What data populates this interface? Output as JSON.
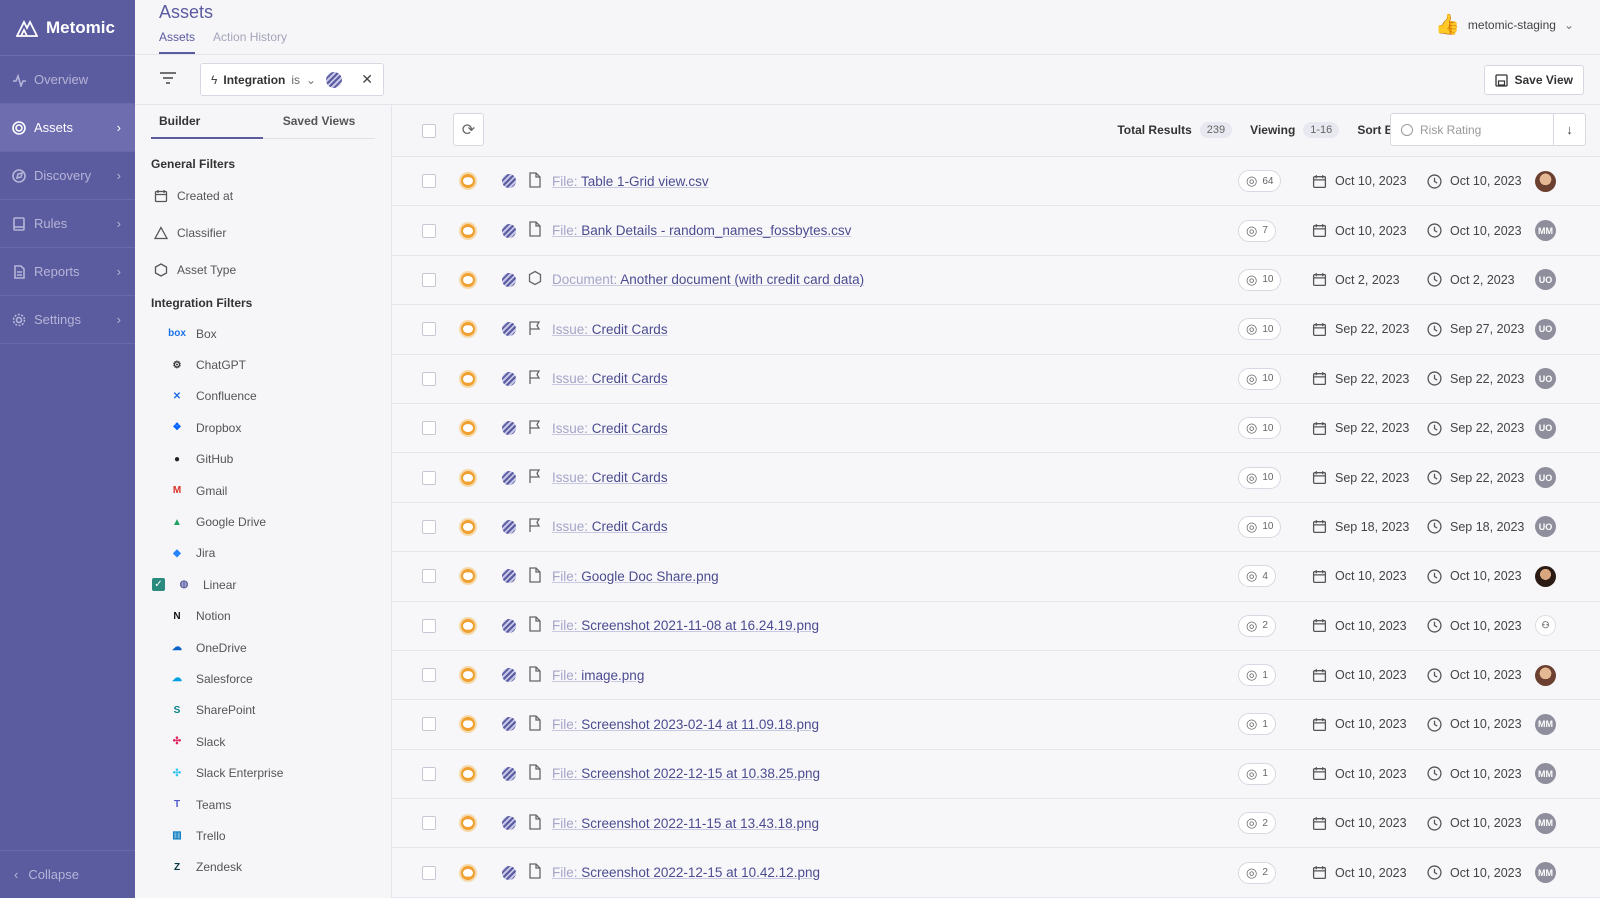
{
  "app": {
    "name": "Metomic"
  },
  "sidebar": {
    "items": [
      {
        "label": "Overview",
        "icon": "activity-icon",
        "active": false,
        "chevron": false
      },
      {
        "label": "Assets",
        "icon": "target-icon",
        "active": true,
        "chevron": true
      },
      {
        "label": "Discovery",
        "icon": "compass-icon",
        "active": false,
        "chevron": true
      },
      {
        "label": "Rules",
        "icon": "book-icon",
        "active": false,
        "chevron": true
      },
      {
        "label": "Reports",
        "icon": "report-icon",
        "active": false,
        "chevron": true
      },
      {
        "label": "Settings",
        "icon": "gear-icon",
        "active": false,
        "chevron": true
      }
    ],
    "collapse_label": "Collapse"
  },
  "header": {
    "title": "Assets",
    "tabs": [
      {
        "label": "Assets",
        "active": true
      },
      {
        "label": "Action History",
        "active": false
      }
    ],
    "account": "metomic-staging"
  },
  "filterbar": {
    "chip": {
      "field": "Integration",
      "operator": "is"
    },
    "save_view_label": "Save View"
  },
  "panel": {
    "tabs": [
      "Builder",
      "Saved Views"
    ],
    "general_title": "General Filters",
    "general": [
      {
        "label": "Created at",
        "icon": "calendar-icon"
      },
      {
        "label": "Classifier",
        "icon": "triangle-icon"
      },
      {
        "label": "Asset Type",
        "icon": "hexagon-icon"
      }
    ],
    "integration_title": "Integration Filters",
    "integrations": [
      {
        "label": "Box",
        "glyph": "box",
        "color": "#1a73e8",
        "checked": false
      },
      {
        "label": "ChatGPT",
        "glyph": "⚙",
        "color": "#333333",
        "checked": false
      },
      {
        "label": "Confluence",
        "glyph": "✕",
        "color": "#1f6feb",
        "checked": false
      },
      {
        "label": "Dropbox",
        "glyph": "❖",
        "color": "#0061fe",
        "checked": false
      },
      {
        "label": "GitHub",
        "glyph": "●",
        "color": "#222222",
        "checked": false
      },
      {
        "label": "Gmail",
        "glyph": "M",
        "color": "#d93025",
        "checked": false
      },
      {
        "label": "Google Drive",
        "glyph": "▲",
        "color": "#1ea362",
        "checked": false
      },
      {
        "label": "Jira",
        "glyph": "◆",
        "color": "#2684ff",
        "checked": false
      },
      {
        "label": "Linear",
        "glyph": "◍",
        "color": "#5b5ba0",
        "checked": true
      },
      {
        "label": "Notion",
        "glyph": "N",
        "color": "#111111",
        "checked": false
      },
      {
        "label": "OneDrive",
        "glyph": "☁",
        "color": "#0a64c8",
        "checked": false
      },
      {
        "label": "Salesforce",
        "glyph": "☁",
        "color": "#00a1e0",
        "checked": false
      },
      {
        "label": "SharePoint",
        "glyph": "S",
        "color": "#038387",
        "checked": false
      },
      {
        "label": "Slack",
        "glyph": "✣",
        "color": "#e01e5a",
        "checked": false
      },
      {
        "label": "Slack Enterprise",
        "glyph": "✣",
        "color": "#36c5f0",
        "checked": false
      },
      {
        "label": "Teams",
        "glyph": "T",
        "color": "#5059c9",
        "checked": false
      },
      {
        "label": "Trello",
        "glyph": "▥",
        "color": "#0079bf",
        "checked": false
      },
      {
        "label": "Zendesk",
        "glyph": "Z",
        "color": "#03363d",
        "checked": false
      }
    ]
  },
  "results": {
    "total_label": "Total Results",
    "total": "239",
    "viewing_label": "Viewing",
    "viewing": "1-16",
    "sort_label": "Sort By",
    "sort_value": "Risk Rating",
    "rows": [
      {
        "kind": "File:",
        "name": "Table 1-Grid view.csv",
        "type": "file",
        "count": "64",
        "created": "Oct 10, 2023",
        "updated": "Oct 10, 2023",
        "user": "photo"
      },
      {
        "kind": "File:",
        "name": "Bank Details - random_names_fossbytes.csv",
        "type": "file",
        "count": "7",
        "created": "Oct 10, 2023",
        "updated": "Oct 10, 2023",
        "user": "MM"
      },
      {
        "kind": "Document:",
        "name": "Another document (with credit card data)",
        "type": "document",
        "count": "10",
        "created": "Oct 2, 2023",
        "updated": "Oct 2, 2023",
        "user": "UO"
      },
      {
        "kind": "Issue:",
        "name": "Credit Cards",
        "type": "issue",
        "count": "10",
        "created": "Sep 22, 2023",
        "updated": "Sep 27, 2023",
        "user": "UO"
      },
      {
        "kind": "Issue:",
        "name": "Credit Cards",
        "type": "issue",
        "count": "10",
        "created": "Sep 22, 2023",
        "updated": "Sep 22, 2023",
        "user": "UO"
      },
      {
        "kind": "Issue:",
        "name": "Credit Cards",
        "type": "issue",
        "count": "10",
        "created": "Sep 22, 2023",
        "updated": "Sep 22, 2023",
        "user": "UO"
      },
      {
        "kind": "Issue:",
        "name": "Credit Cards",
        "type": "issue",
        "count": "10",
        "created": "Sep 22, 2023",
        "updated": "Sep 22, 2023",
        "user": "UO"
      },
      {
        "kind": "Issue:",
        "name": "Credit Cards",
        "type": "issue",
        "count": "10",
        "created": "Sep 18, 2023",
        "updated": "Sep 18, 2023",
        "user": "UO"
      },
      {
        "kind": "File:",
        "name": "Google Doc Share.png",
        "type": "file",
        "count": "4",
        "created": "Oct 10, 2023",
        "updated": "Oct 10, 2023",
        "user": "photo2"
      },
      {
        "kind": "File:",
        "name": "Screenshot 2021-11-08 at 16.24.19.png",
        "type": "file",
        "count": "2",
        "created": "Oct 10, 2023",
        "updated": "Oct 10, 2023",
        "user": "none"
      },
      {
        "kind": "File:",
        "name": "image.png",
        "type": "file",
        "count": "1",
        "created": "Oct 10, 2023",
        "updated": "Oct 10, 2023",
        "user": "photo"
      },
      {
        "kind": "File:",
        "name": "Screenshot 2023-02-14 at 11.09.18.png",
        "type": "file",
        "count": "1",
        "created": "Oct 10, 2023",
        "updated": "Oct 10, 2023",
        "user": "MM"
      },
      {
        "kind": "File:",
        "name": "Screenshot 2022-12-15 at 10.38.25.png",
        "type": "file",
        "count": "1",
        "created": "Oct 10, 2023",
        "updated": "Oct 10, 2023",
        "user": "MM"
      },
      {
        "kind": "File:",
        "name": "Screenshot 2022-11-15 at 13.43.18.png",
        "type": "file",
        "count": "2",
        "created": "Oct 10, 2023",
        "updated": "Oct 10, 2023",
        "user": "MM"
      },
      {
        "kind": "File:",
        "name": "Screenshot 2022-12-15 at 10.42.12.png",
        "type": "file",
        "count": "2",
        "created": "Oct 10, 2023",
        "updated": "Oct 10, 2023",
        "user": "MM"
      }
    ]
  },
  "colors": {
    "brand": "#5b5ba0",
    "risk": "#f0a030",
    "check": "#2a8a7e"
  }
}
